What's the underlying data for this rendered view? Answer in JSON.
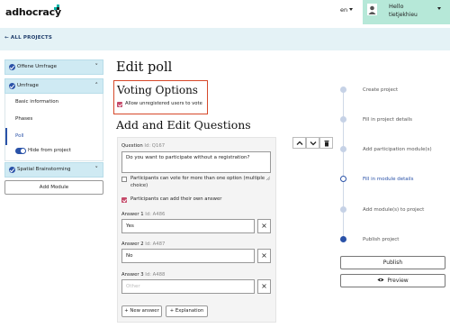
{
  "header": {
    "logo": "adhocracy",
    "language": "en",
    "user_greeting": "Hello",
    "user_name": "tietjekhieu",
    "all_projects": "← ALL PROJECTS"
  },
  "sidebar": {
    "modules": [
      {
        "label": "Offene Umfrage",
        "chevron": "˅"
      },
      {
        "label": "Umfrage",
        "chevron": "˄"
      },
      {
        "label": "Spatial Brainstorming",
        "chevron": "˅"
      }
    ],
    "subitems": [
      "Basic information",
      "Phases",
      "Poll"
    ],
    "active_subitem": "Poll",
    "toggle_label": "Hide from project",
    "add_module": "Add Module"
  },
  "main": {
    "title": "Edit poll",
    "voting_options": {
      "title": "Voting Options",
      "checkbox_label": "Allow unregistered users to vote",
      "checked": true
    },
    "questions_title": "Add and Edit Questions",
    "question": {
      "label": "Question",
      "id": "Id: Q167",
      "text": "Do you want to participate without a registration?",
      "multi_label": "Participants can vote for more than one option (multiple",
      "multi_label_2": "choice)",
      "multi_checked": false,
      "own_answer_label": "Participants can add their own answer",
      "own_answer_checked": true,
      "answers": [
        {
          "label": "Answer 1",
          "id": "Id: A486",
          "value": "Yes",
          "placeholder": ""
        },
        {
          "label": "Answer 2",
          "id": "Id: A487",
          "value": "No",
          "placeholder": ""
        },
        {
          "label": "Answer 3",
          "id": "Id: A488",
          "value": "",
          "placeholder": "Other"
        }
      ],
      "remove_symbol": "×",
      "new_answer": "+ New answer",
      "explanation": "+ Explanation"
    }
  },
  "steps": {
    "items": [
      "Create project",
      "Fill in project details",
      "Add participation module(s)",
      "Fill in module details",
      "Add module(s) to project",
      "Publish project"
    ],
    "current": "Fill in module details",
    "publish": "Publish",
    "preview": "Preview"
  },
  "colors": {
    "accent": "#2a52a8",
    "highlight_box": "#d6492a",
    "checkbox": "#c54a6a",
    "user_panel": "#b6e8d8",
    "project_bar": "#e4f2f6",
    "sidebar_item": "#cfeaf3"
  }
}
